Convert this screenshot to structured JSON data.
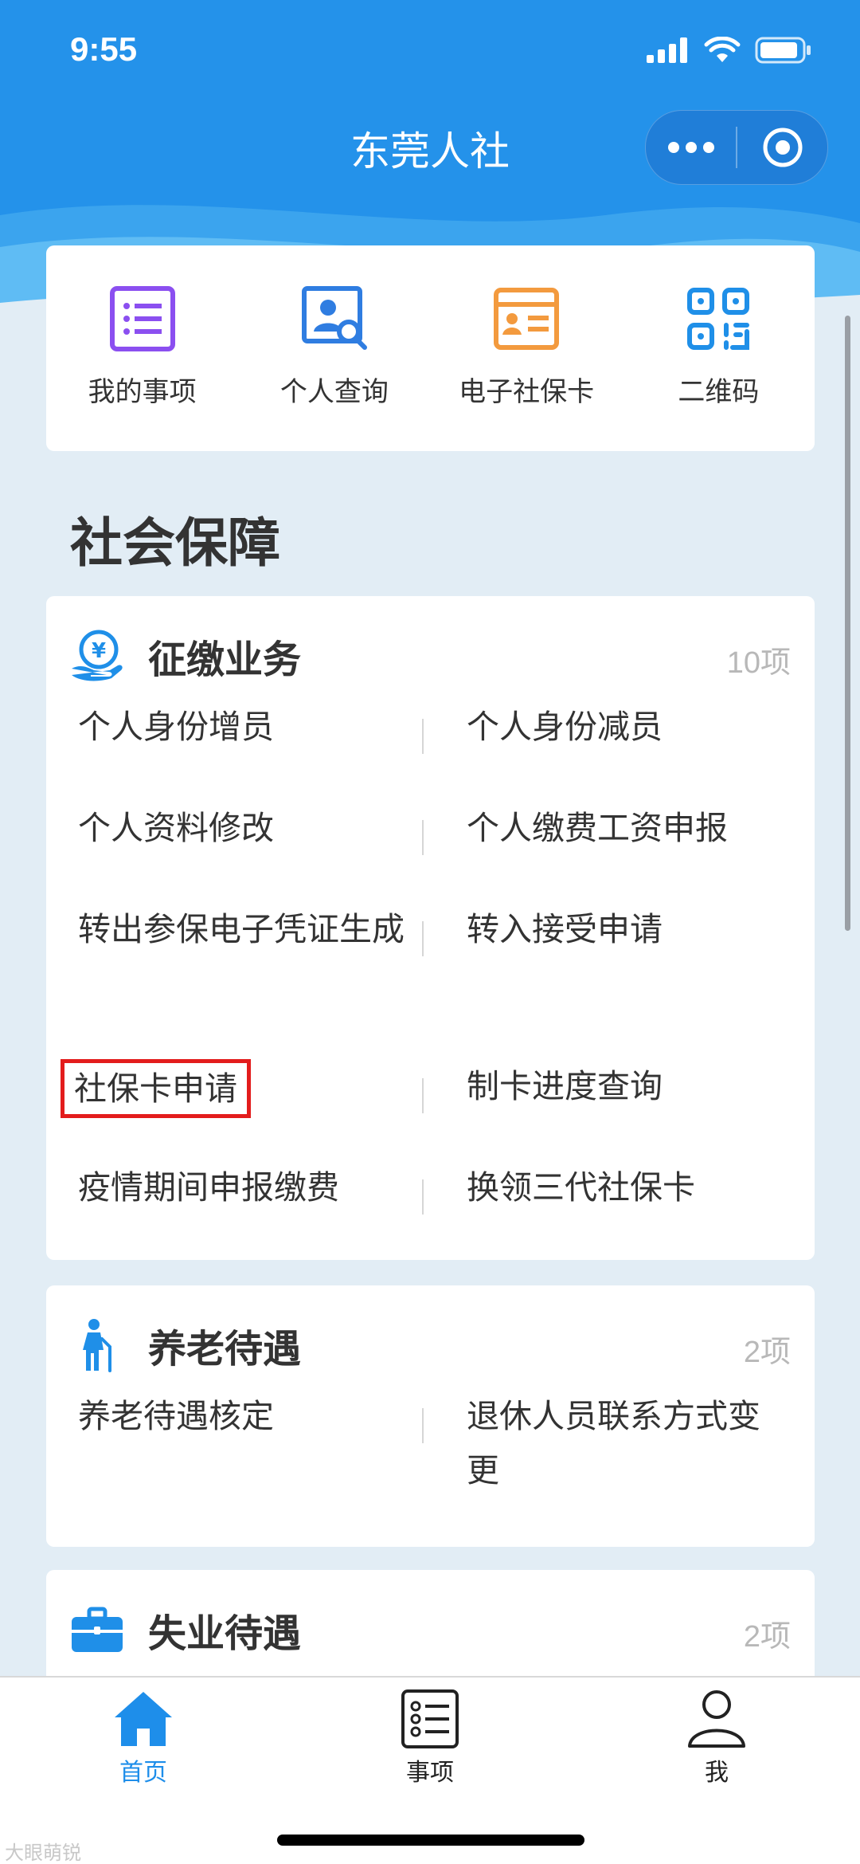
{
  "status_bar": {
    "time": "9:55"
  },
  "nav": {
    "title": "东莞人社"
  },
  "quick_actions": [
    {
      "label": "我的事项",
      "icon": "list-icon"
    },
    {
      "label": "个人查询",
      "icon": "person-search-icon"
    },
    {
      "label": "电子社保卡",
      "icon": "id-card-icon"
    },
    {
      "label": "二维码",
      "icon": "qr-code-icon"
    }
  ],
  "section": {
    "title": "社会保障"
  },
  "cards": [
    {
      "title": "征缴业务",
      "count": "10项",
      "icon": "yen-hand-icon",
      "rows": [
        [
          "个人身份增员",
          "个人身份减员"
        ],
        [
          "个人资料修改",
          "个人缴费工资申报"
        ],
        [
          "转出参保电子凭证生成",
          "转入接受申请"
        ],
        [
          "社保卡申请",
          "制卡进度查询"
        ],
        [
          "疫情期间申报缴费",
          "换领三代社保卡"
        ]
      ]
    },
    {
      "title": "养老待遇",
      "count": "2项",
      "icon": "elderly-person-icon",
      "rows": [
        [
          "养老待遇核定",
          "退休人员联系方式变更"
        ]
      ]
    },
    {
      "title": "失业待遇",
      "count": "2项",
      "icon": "briefcase-icon"
    }
  ],
  "tabbar": {
    "home": "首页",
    "items": "事项",
    "me": "我"
  },
  "watermark": "大眼萌锐",
  "colors": {
    "header_blue": "#2492ea",
    "accent": "#1e8eea",
    "highlight_red": "#e31c1c"
  }
}
